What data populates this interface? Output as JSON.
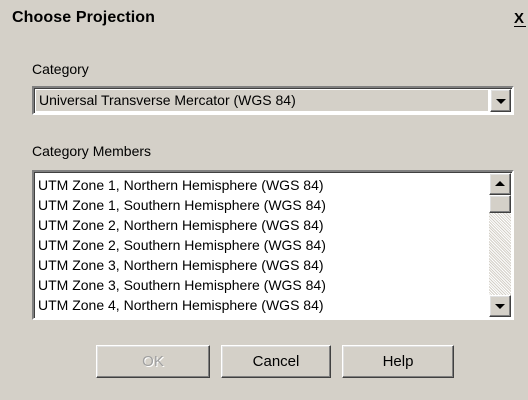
{
  "window": {
    "title": "Choose Projection",
    "close_label": "X"
  },
  "category": {
    "label": "Category",
    "selected_value": "Universal Transverse Mercator (WGS 84)"
  },
  "members": {
    "label": "Category Members",
    "items": [
      "UTM Zone 1, Northern Hemisphere (WGS 84)",
      "UTM Zone 1, Southern Hemisphere (WGS 84)",
      "UTM Zone 2, Northern Hemisphere (WGS 84)",
      "UTM Zone 2, Southern Hemisphere (WGS 84)",
      "UTM Zone 3, Northern Hemisphere (WGS 84)",
      "UTM Zone 3, Southern Hemisphere (WGS 84)",
      "UTM Zone 4, Northern Hemisphere (WGS 84)"
    ]
  },
  "buttons": {
    "ok_label": "OK",
    "cancel_label": "Cancel",
    "help_label": "Help"
  },
  "icons": {
    "combo_arrow": "chevron-down-icon",
    "scroll_up": "chevron-up-icon",
    "scroll_down": "chevron-down-icon"
  },
  "colors": {
    "dialog_background": "#d4d0c8",
    "field_background": "#ffffff",
    "disabled_text": "#a0a0a0"
  }
}
